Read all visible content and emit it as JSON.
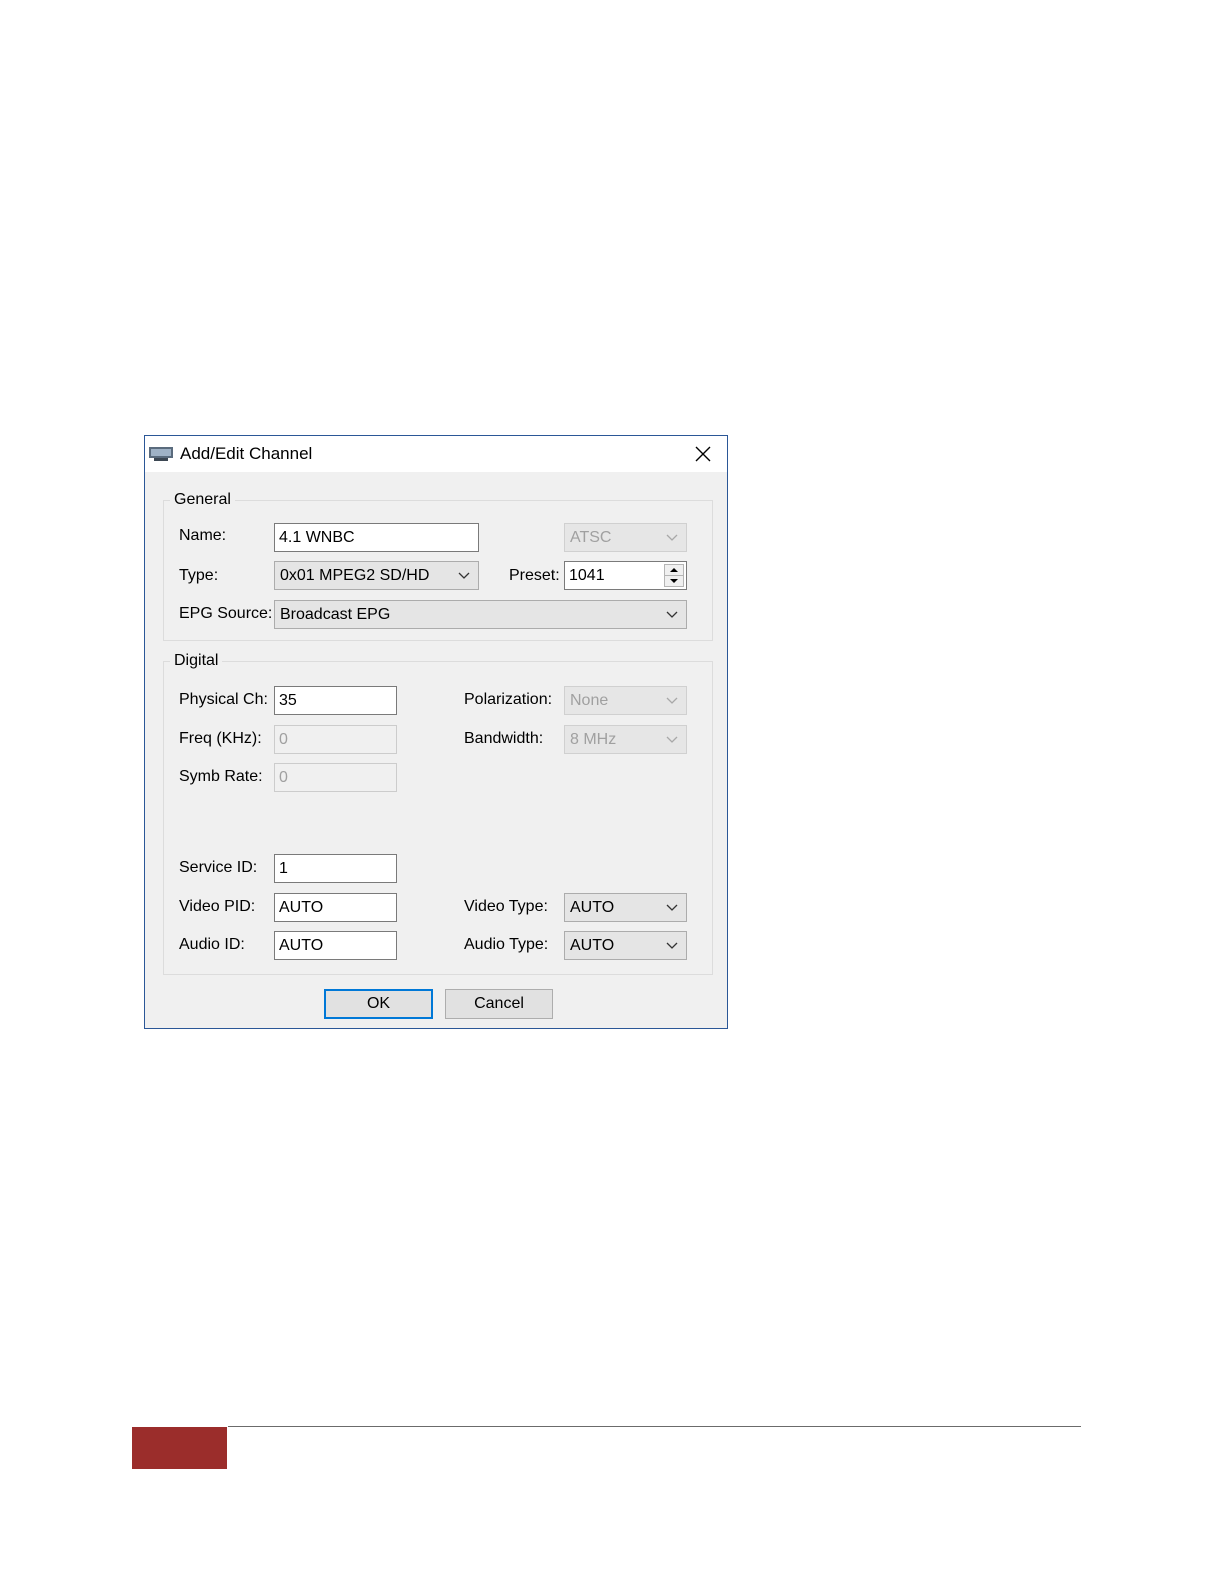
{
  "dialog": {
    "title": "Add/Edit Channel",
    "general": {
      "legend": "General",
      "name_label": "Name:",
      "name_value": "4.1  WNBC",
      "standard_value": "ATSC",
      "type_label": "Type:",
      "type_value": "0x01 MPEG2 SD/HD",
      "preset_label": "Preset:",
      "preset_value": "1041",
      "epg_label": "EPG Source:",
      "epg_value": "Broadcast EPG"
    },
    "digital": {
      "legend": "Digital",
      "physical_label": "Physical Ch:",
      "physical_value": "35",
      "freq_label": "Freq (KHz):",
      "freq_value": "0",
      "symb_label": "Symb Rate:",
      "symb_value": "0",
      "polarization_label": "Polarization:",
      "polarization_value": "None",
      "bandwidth_label": "Bandwidth:",
      "bandwidth_value": "8 MHz",
      "service_label": "Service ID:",
      "service_value": "1",
      "video_pid_label": "Video PID:",
      "video_pid_value": "AUTO",
      "audio_id_label": "Audio ID:",
      "audio_id_value": "AUTO",
      "video_type_label": "Video Type:",
      "video_type_value": "AUTO",
      "audio_type_label": "Audio Type:",
      "audio_type_value": "AUTO"
    },
    "buttons": {
      "ok": "OK",
      "cancel": "Cancel"
    }
  },
  "colors": {
    "accent": "#0078d7",
    "footer_block": "#9b2d2b",
    "window_border": "#2b5797"
  }
}
